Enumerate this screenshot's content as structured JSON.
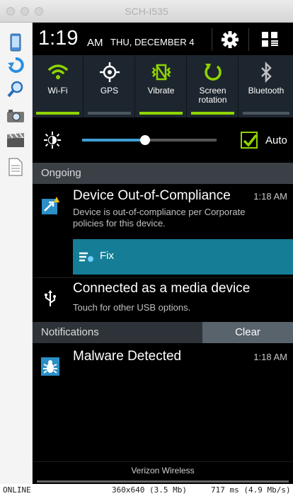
{
  "window": {
    "title": "SCH-I535"
  },
  "status_bar": {
    "time": "1:19",
    "ampm": "AM",
    "date": "THU, DECEMBER 4"
  },
  "quick_settings": [
    {
      "label": "Wi-Fi",
      "icon": "wifi-icon",
      "on": true
    },
    {
      "label": "GPS",
      "icon": "gps-icon",
      "on": false
    },
    {
      "label": "Vibrate",
      "icon": "vibrate-icon",
      "on": true
    },
    {
      "label": "Screen rotation",
      "icon": "rotation-icon",
      "on": true
    },
    {
      "label": "Bluetooth",
      "icon": "bluetooth-icon",
      "on": false
    }
  ],
  "brightness": {
    "level": 0.47,
    "auto_label": "Auto",
    "auto_checked": true
  },
  "ongoing": {
    "header": "Ongoing",
    "compliance": {
      "title": "Device Out-of-Compliance",
      "time": "1:18 AM",
      "text": "Device is out-of-compliance per Corporate policies for this device.",
      "action_label": "Fix"
    },
    "usb": {
      "title": "Connected as a media device",
      "text": "Touch for other USB options."
    }
  },
  "notifications": {
    "header": "Notifications",
    "clear_label": "Clear",
    "malware": {
      "title": "Malware Detected",
      "time": "1:18 AM"
    }
  },
  "carrier": "Verizon Wireless",
  "footer": {
    "status": "ONLINE",
    "resolution": "360x640 (3.5 Mb)",
    "timing": "717 ms (4.9 Mb/s)"
  },
  "colors": {
    "accent_green": "#8fd400",
    "fix_blue": "#157e96",
    "slider_blue": "#3ea0d4"
  }
}
